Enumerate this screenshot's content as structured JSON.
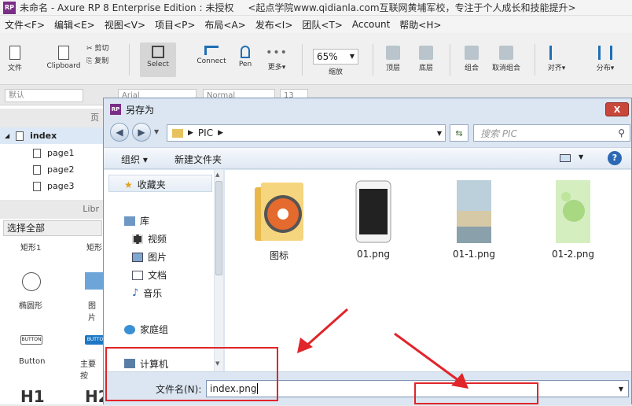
{
  "app": {
    "title": "未命名 - Axure RP 8 Enterprise Edition : 未授权",
    "tagline": "<起点学院www.qidianla.com互联网黄埔军校，专注于个人成长和技能提升>",
    "logo_text": "RP"
  },
  "menu": [
    "文件<F>",
    "编辑<E>",
    "视图<V>",
    "项目<P>",
    "布局<A>",
    "发布<I>",
    "团队<T>",
    "Account",
    "帮助<H>"
  ],
  "toolbar": {
    "file": "文件",
    "clipboard": "Clipboard",
    "cut": "剪切",
    "copy": "复制",
    "select": "Select",
    "connect": "Connect",
    "pen": "Pen",
    "more": "更多▾",
    "zoom_value": "65%",
    "zoom_label": "缩放",
    "top": "顶层",
    "bottom": "底层",
    "group": "组合",
    "ungroup": "取消组合",
    "align": "对齐▾",
    "distribute": "分布▾"
  },
  "formatbar": {
    "style": "默认",
    "font": "Arial",
    "weight": "Normal",
    "size": "13"
  },
  "leftpanel": {
    "pages_header": "页",
    "pages": [
      "index",
      "page1",
      "page2",
      "page3"
    ],
    "library_header": "Libr",
    "library_select": "选择全部",
    "widgets": [
      "矩形1",
      "矩形",
      "椭圆形",
      "图片",
      "Button",
      "主要按",
      "H1",
      "H2"
    ],
    "button_widget_text": "BUTTON",
    "button2_widget_text": "BUTTO"
  },
  "dialog": {
    "title": "另存为",
    "close": "X",
    "path": "PIC",
    "search_placeholder": "搜索 PIC",
    "organize": "组织 ▾",
    "new_folder": "新建文件夹",
    "help": "?",
    "nav": {
      "favorites": "收藏夹",
      "libraries": "库",
      "videos": "视频",
      "pictures": "图片",
      "documents": "文档",
      "music": "音乐",
      "homegroup": "家庭组",
      "computer": "计算机"
    },
    "files": [
      "图标",
      "01.png",
      "01-1.png",
      "01-2.png"
    ],
    "filename_label": "文件名(N):",
    "filename_value": "index.png"
  },
  "colors": {
    "accent_red": "#e0252b",
    "dialog_bg": "#dbe6f2",
    "rp_purple": "#7a2f86"
  }
}
